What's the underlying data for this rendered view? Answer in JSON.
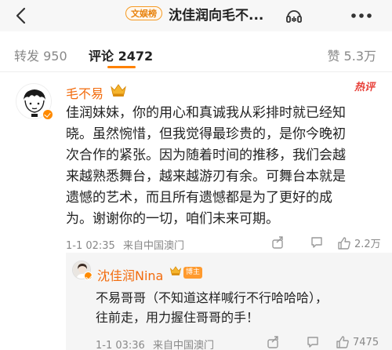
{
  "header": {
    "topic_badge": "文娱榜",
    "title": "沈佳润向毛不..."
  },
  "tabs": {
    "repost_label": "转发",
    "repost_count": "950",
    "comment_label": "评论",
    "comment_count": "2472",
    "like_label": "赞",
    "like_count": "5.3万"
  },
  "comment": {
    "user": "毛不易",
    "hot_badge": "热评",
    "lines": [
      "佳润妹妹，你的用心和真诚我从彩排时就已经知",
      "晓。虽然惋惜，但我觉得最珍贵的，是你今晚初",
      "次合作的紧张。因为随着时间的推移，我们会越",
      "来越熟悉舞台，越来越游刃有余。可舞台本就是",
      "遗憾的艺术，而且所有遗憾都是为了更好的成",
      "为。谢谢你的一切，咱们未来可期。"
    ],
    "time": "1-1 02:35",
    "location": "来自中国澳门",
    "likes": "2.2万"
  },
  "reply": {
    "user": "沈佳润Nina",
    "badge": "博主",
    "lines": [
      "不易哥哥（不知道这样喊行不行哈哈哈），",
      "往前走，用力握住哥哥的手！"
    ],
    "time": "1-1 03:36",
    "location": "来自中国澳门",
    "likes": "7475"
  },
  "colors": {
    "accent": "#ff8200",
    "username": "#f26c0e",
    "hot": "#e8423b"
  },
  "icons": [
    "back-arrow-icon",
    "music-icon",
    "more-icon",
    "crown-icon",
    "share-icon",
    "comment-icon",
    "like-icon",
    "verified-icon"
  ]
}
